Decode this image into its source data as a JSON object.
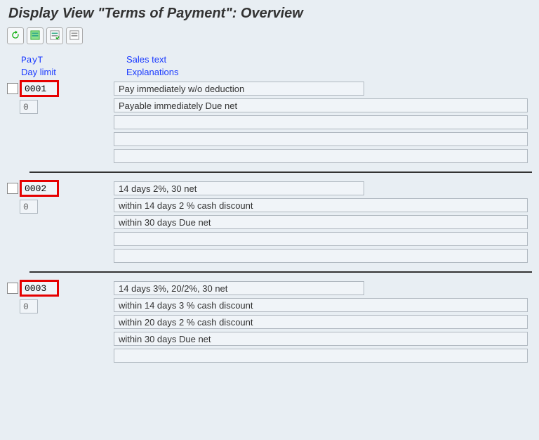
{
  "page_title": "Display View \"Terms of Payment\": Overview",
  "toolbar": {
    "refresh_icon": "refresh-icon",
    "select_all_icon": "select-all-icon",
    "select_block_icon": "select-block-icon",
    "deselect_all_icon": "deselect-all-icon"
  },
  "headers": {
    "payt": "PayT",
    "day_limit": "Day limit",
    "sales_text": "Sales text",
    "explanations": "Explanations"
  },
  "records": [
    {
      "payt": "0001",
      "day_limit": "0",
      "sales_text": "Pay immediately w/o deduction",
      "explanations": [
        "Payable immediately Due net",
        "",
        "",
        ""
      ]
    },
    {
      "payt": "0002",
      "day_limit": "0",
      "sales_text": "14 days 2%, 30 net",
      "explanations": [
        "within 14 days 2 % cash discount",
        "within 30 days Due net",
        "",
        ""
      ]
    },
    {
      "payt": "0003",
      "day_limit": "0",
      "sales_text": "14 days 3%, 20/2%, 30 net",
      "explanations": [
        "within 14 days 3 % cash discount",
        "within 20 days 2 % cash discount",
        "within 30 days Due net",
        ""
      ]
    }
  ]
}
